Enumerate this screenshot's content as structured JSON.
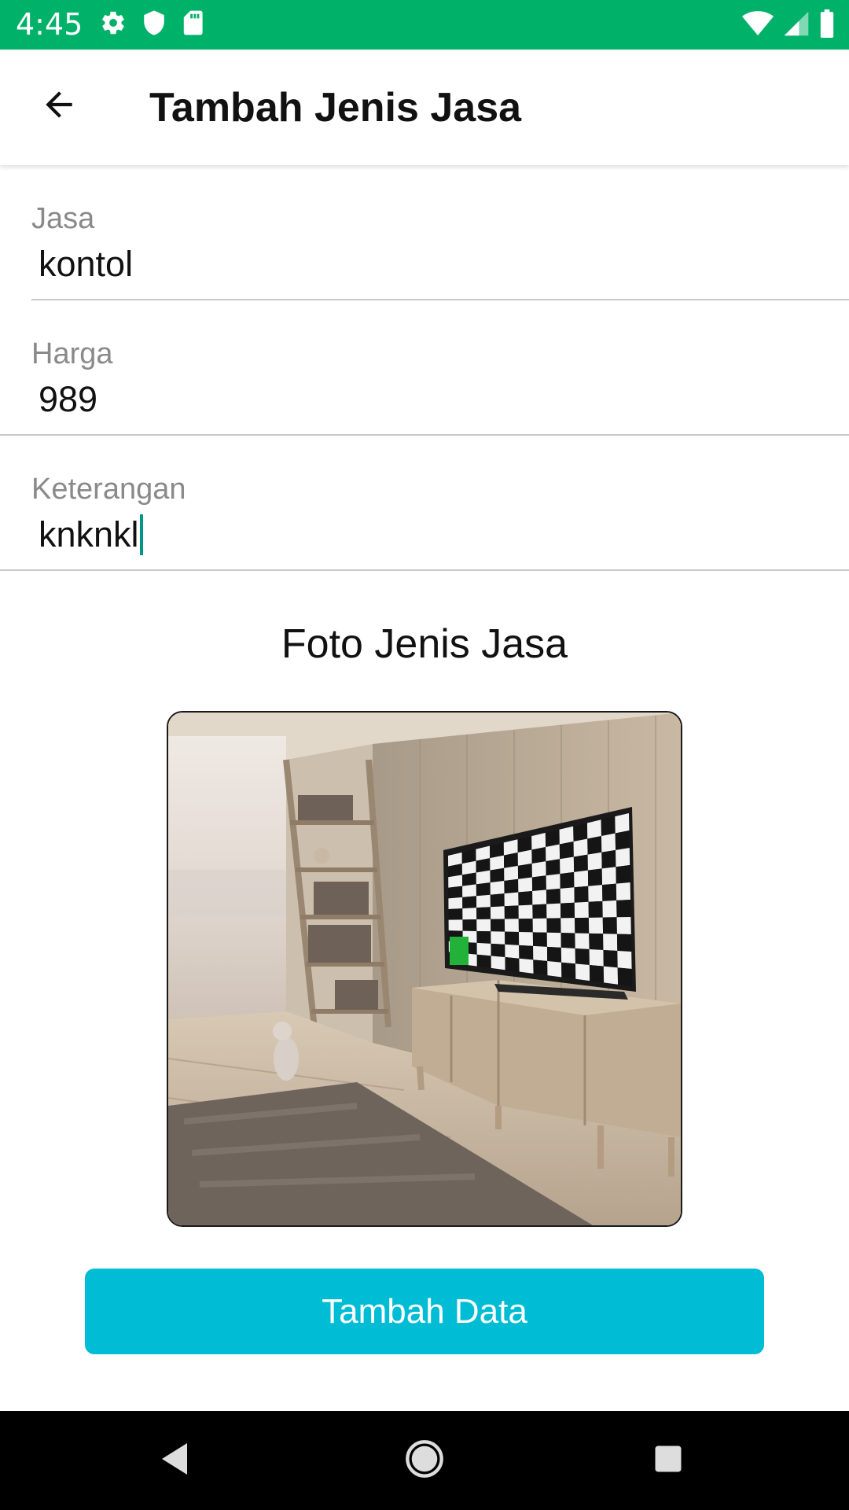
{
  "status_bar": {
    "time": "4:45",
    "background": "#00b269",
    "left_icons": [
      "settings-gear-icon",
      "shield-icon",
      "sd-card-icon"
    ],
    "right_icons": [
      "wifi-icon",
      "cell-signal-icon",
      "battery-icon"
    ]
  },
  "app_bar": {
    "back_icon": "arrow-left-icon",
    "title": "Tambah Jenis Jasa"
  },
  "form": {
    "jasa": {
      "label": "Jasa",
      "value": "kontol"
    },
    "harga": {
      "label": "Harga",
      "value": "989"
    },
    "keterangan": {
      "label": "Keterangan",
      "value": "knknkl"
    }
  },
  "photo_section": {
    "title": "Foto Jenis Jasa"
  },
  "submit_button": {
    "label": "Tambah Data",
    "color": "#00bcd4"
  },
  "nav_bar": {
    "icons": [
      "back-triangle-icon",
      "home-circle-icon",
      "recents-square-icon"
    ]
  },
  "colors": {
    "accent": "#009688",
    "status_bar": "#00b269",
    "button": "#00bcd4"
  }
}
